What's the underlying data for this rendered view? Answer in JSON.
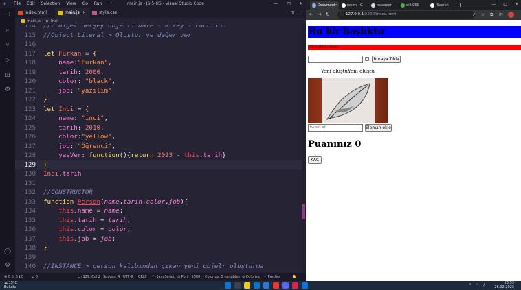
{
  "vscode": {
    "menu": [
      "File",
      "Edit",
      "Selection",
      "View",
      "Go",
      "Run",
      "···"
    ],
    "window_title": "main.js - JS-5-HS - Visual Studio Code",
    "window_controls": [
      "—",
      "□",
      "✕"
    ],
    "tabs": [
      {
        "label": "index.html",
        "icon": "html-file-icon",
        "color": "#e44d26",
        "active": false
      },
      {
        "label": "main.js",
        "icon": "js-file-icon",
        "color": "#e5c100",
        "active": true
      },
      {
        "label": "style.css",
        "icon": "css-file-icon",
        "color": "#c6538c",
        "active": false
      }
    ],
    "tab_controls": [
      "◫",
      "···"
    ],
    "breadcrumb": {
      "file": "main.js",
      "symbol": "[ø] İnci"
    },
    "current_line": 129,
    "lines": [
      {
        "no": 114,
        "tokens": [
          [
            "cm",
            "//: Diğer herşey object: Date - Array - Function"
          ]
        ]
      },
      {
        "no": 115,
        "tokens": [
          [
            "cm",
            "//Object Literal > Oluştur ve değer ver"
          ]
        ]
      },
      {
        "no": 116,
        "tokens": []
      },
      {
        "no": 117,
        "tokens": [
          [
            "k",
            "let "
          ],
          [
            "n",
            "Furkan"
          ],
          [
            "pl",
            " = "
          ],
          [
            "k",
            "{"
          ]
        ]
      },
      {
        "no": 118,
        "tokens": [
          [
            "pl",
            "    "
          ],
          [
            "p",
            "name"
          ],
          [
            "pl",
            ":"
          ],
          [
            "s",
            "\"Furkan\""
          ],
          [
            "pl",
            ","
          ]
        ]
      },
      {
        "no": 119,
        "tokens": [
          [
            "pl",
            "    "
          ],
          [
            "p",
            "tarih"
          ],
          [
            "pl",
            ": "
          ],
          [
            "n",
            "2000"
          ],
          [
            "pl",
            ","
          ]
        ]
      },
      {
        "no": 120,
        "tokens": [
          [
            "pl",
            "    "
          ],
          [
            "p",
            "color"
          ],
          [
            "pl",
            ": "
          ],
          [
            "s",
            "\"black\""
          ],
          [
            "pl",
            ","
          ]
        ]
      },
      {
        "no": 121,
        "tokens": [
          [
            "pl",
            "    "
          ],
          [
            "p",
            "job"
          ],
          [
            "pl",
            ": "
          ],
          [
            "s",
            "\"yazilim\""
          ]
        ]
      },
      {
        "no": 122,
        "tokens": [
          [
            "k",
            "}"
          ]
        ]
      },
      {
        "no": 123,
        "tokens": [
          [
            "k",
            "let "
          ],
          [
            "n",
            "İnci"
          ],
          [
            "pl",
            " = "
          ],
          [
            "k",
            "{"
          ]
        ]
      },
      {
        "no": 124,
        "tokens": [
          [
            "pl",
            "    "
          ],
          [
            "p",
            "name"
          ],
          [
            "pl",
            ": "
          ],
          [
            "s",
            "\"inci\""
          ],
          [
            "pl",
            ","
          ]
        ]
      },
      {
        "no": 125,
        "tokens": [
          [
            "pl",
            "    "
          ],
          [
            "p",
            "tarih"
          ],
          [
            "pl",
            ": "
          ],
          [
            "n",
            "2010"
          ],
          [
            "pl",
            ","
          ]
        ]
      },
      {
        "no": 126,
        "tokens": [
          [
            "pl",
            "    "
          ],
          [
            "p",
            "color"
          ],
          [
            "pl",
            ":"
          ],
          [
            "s",
            "\"yellow\""
          ],
          [
            "pl",
            ","
          ]
        ]
      },
      {
        "no": 127,
        "tokens": [
          [
            "pl",
            "    "
          ],
          [
            "p",
            "job"
          ],
          [
            "pl",
            ": "
          ],
          [
            "s",
            "\"Öğrenci\""
          ],
          [
            "pl",
            ","
          ]
        ]
      },
      {
        "no": 128,
        "tokens": [
          [
            "pl",
            "    "
          ],
          [
            "p",
            "yasVer"
          ],
          [
            "pl",
            ": "
          ],
          [
            "k",
            "function"
          ],
          [
            "pl",
            "(){"
          ],
          [
            "k",
            "return "
          ],
          [
            "n",
            "2023"
          ],
          [
            "pl",
            " - "
          ],
          [
            "th",
            "this"
          ],
          [
            "pl",
            "."
          ],
          [
            "p",
            "tarih"
          ],
          [
            "pl",
            "}"
          ]
        ]
      },
      {
        "no": 129,
        "tokens": [
          [
            "k",
            "}"
          ]
        ]
      },
      {
        "no": 130,
        "tokens": [
          [
            "n",
            "İnci"
          ],
          [
            "pl",
            "."
          ],
          [
            "p",
            "tarih"
          ]
        ]
      },
      {
        "no": 131,
        "tokens": []
      },
      {
        "no": 132,
        "tokens": [
          [
            "cm",
            "//CONSTRUCTOR"
          ]
        ]
      },
      {
        "no": 133,
        "tokens": [
          [
            "k",
            "function "
          ],
          [
            "cls",
            "Person"
          ],
          [
            "pl",
            "("
          ],
          [
            "pa",
            "name"
          ],
          [
            "pl",
            ","
          ],
          [
            "pa",
            "tarih"
          ],
          [
            "pl",
            ","
          ],
          [
            "pa",
            "color"
          ],
          [
            "pl",
            ","
          ],
          [
            "pa",
            "job"
          ],
          [
            "pl",
            "){"
          ]
        ]
      },
      {
        "no": 134,
        "tokens": [
          [
            "pl",
            "    "
          ],
          [
            "th",
            "this"
          ],
          [
            "pl",
            "."
          ],
          [
            "p",
            "name"
          ],
          [
            "pl",
            " = "
          ],
          [
            "pa",
            "name"
          ],
          [
            "pl",
            ";"
          ]
        ]
      },
      {
        "no": 135,
        "tokens": [
          [
            "pl",
            "    "
          ],
          [
            "th",
            "this"
          ],
          [
            "pl",
            "."
          ],
          [
            "p",
            "tarih"
          ],
          [
            "pl",
            " = "
          ],
          [
            "pa",
            "tarih"
          ],
          [
            "pl",
            ";"
          ]
        ]
      },
      {
        "no": 136,
        "tokens": [
          [
            "pl",
            "    "
          ],
          [
            "th",
            "this"
          ],
          [
            "pl",
            "."
          ],
          [
            "p",
            "color"
          ],
          [
            "pl",
            " = "
          ],
          [
            "pa",
            "color"
          ],
          [
            "pl",
            ";"
          ]
        ]
      },
      {
        "no": 137,
        "tokens": [
          [
            "pl",
            "    "
          ],
          [
            "th",
            "this"
          ],
          [
            "pl",
            "."
          ],
          [
            "p",
            "job"
          ],
          [
            "pl",
            " = "
          ],
          [
            "pa",
            "job"
          ],
          [
            "pl",
            ";"
          ]
        ]
      },
      {
        "no": 138,
        "tokens": [
          [
            "k",
            "}"
          ]
        ]
      },
      {
        "no": 139,
        "tokens": []
      },
      {
        "no": 140,
        "tokens": [
          [
            "cm",
            "//INSTANCE > person kalıbından çıkan yeni objelr oluşturma"
          ]
        ]
      },
      {
        "no": 141,
        "tokens": []
      }
    ],
    "status": {
      "problems": "⊗ 0 ⚠ 0 ℹ 0",
      "branch": "⇄ 0",
      "position": "Ln 129, Col 2",
      "spaces": "Spaces: 4",
      "encoding": "UTF-8",
      "eol": "CRLF",
      "language": "{} JavaScript",
      "port": "⊘ Port : 5500",
      "colorize": "Colorize: 0 variables",
      "colorize2": "⊘ Colorize",
      "prettier": "✓ Prettier"
    }
  },
  "browser": {
    "tabs": [
      "Document",
      "resim - G",
      "masaeon",
      "w3.CSS",
      "JSearch"
    ],
    "url_host": "127.0.0.1",
    "url_path": ":5500/index.html",
    "window_controls": [
      "—",
      "□",
      "✕"
    ]
  },
  "page": {
    "heading": "Bu bir başlıktır",
    "paragraph": "Paragraf alanı",
    "button_click": "Buraya Tıkla",
    "yeni_text": "Yeni oluştuYeni oluştu",
    "tweet_placeholder": "tweet at",
    "add_button": "Eleman ekle",
    "score": "Puanınız 0",
    "escape_button": "KAÇ"
  },
  "taskbar": {
    "temp": "15°C",
    "weather": "Bulutlu",
    "time": "23:53",
    "date": "26.02.2023"
  },
  "colors": {
    "heading_bg": "#0000ff",
    "paragraph_bg": "#ff0000",
    "editor_bg": "#262335"
  }
}
